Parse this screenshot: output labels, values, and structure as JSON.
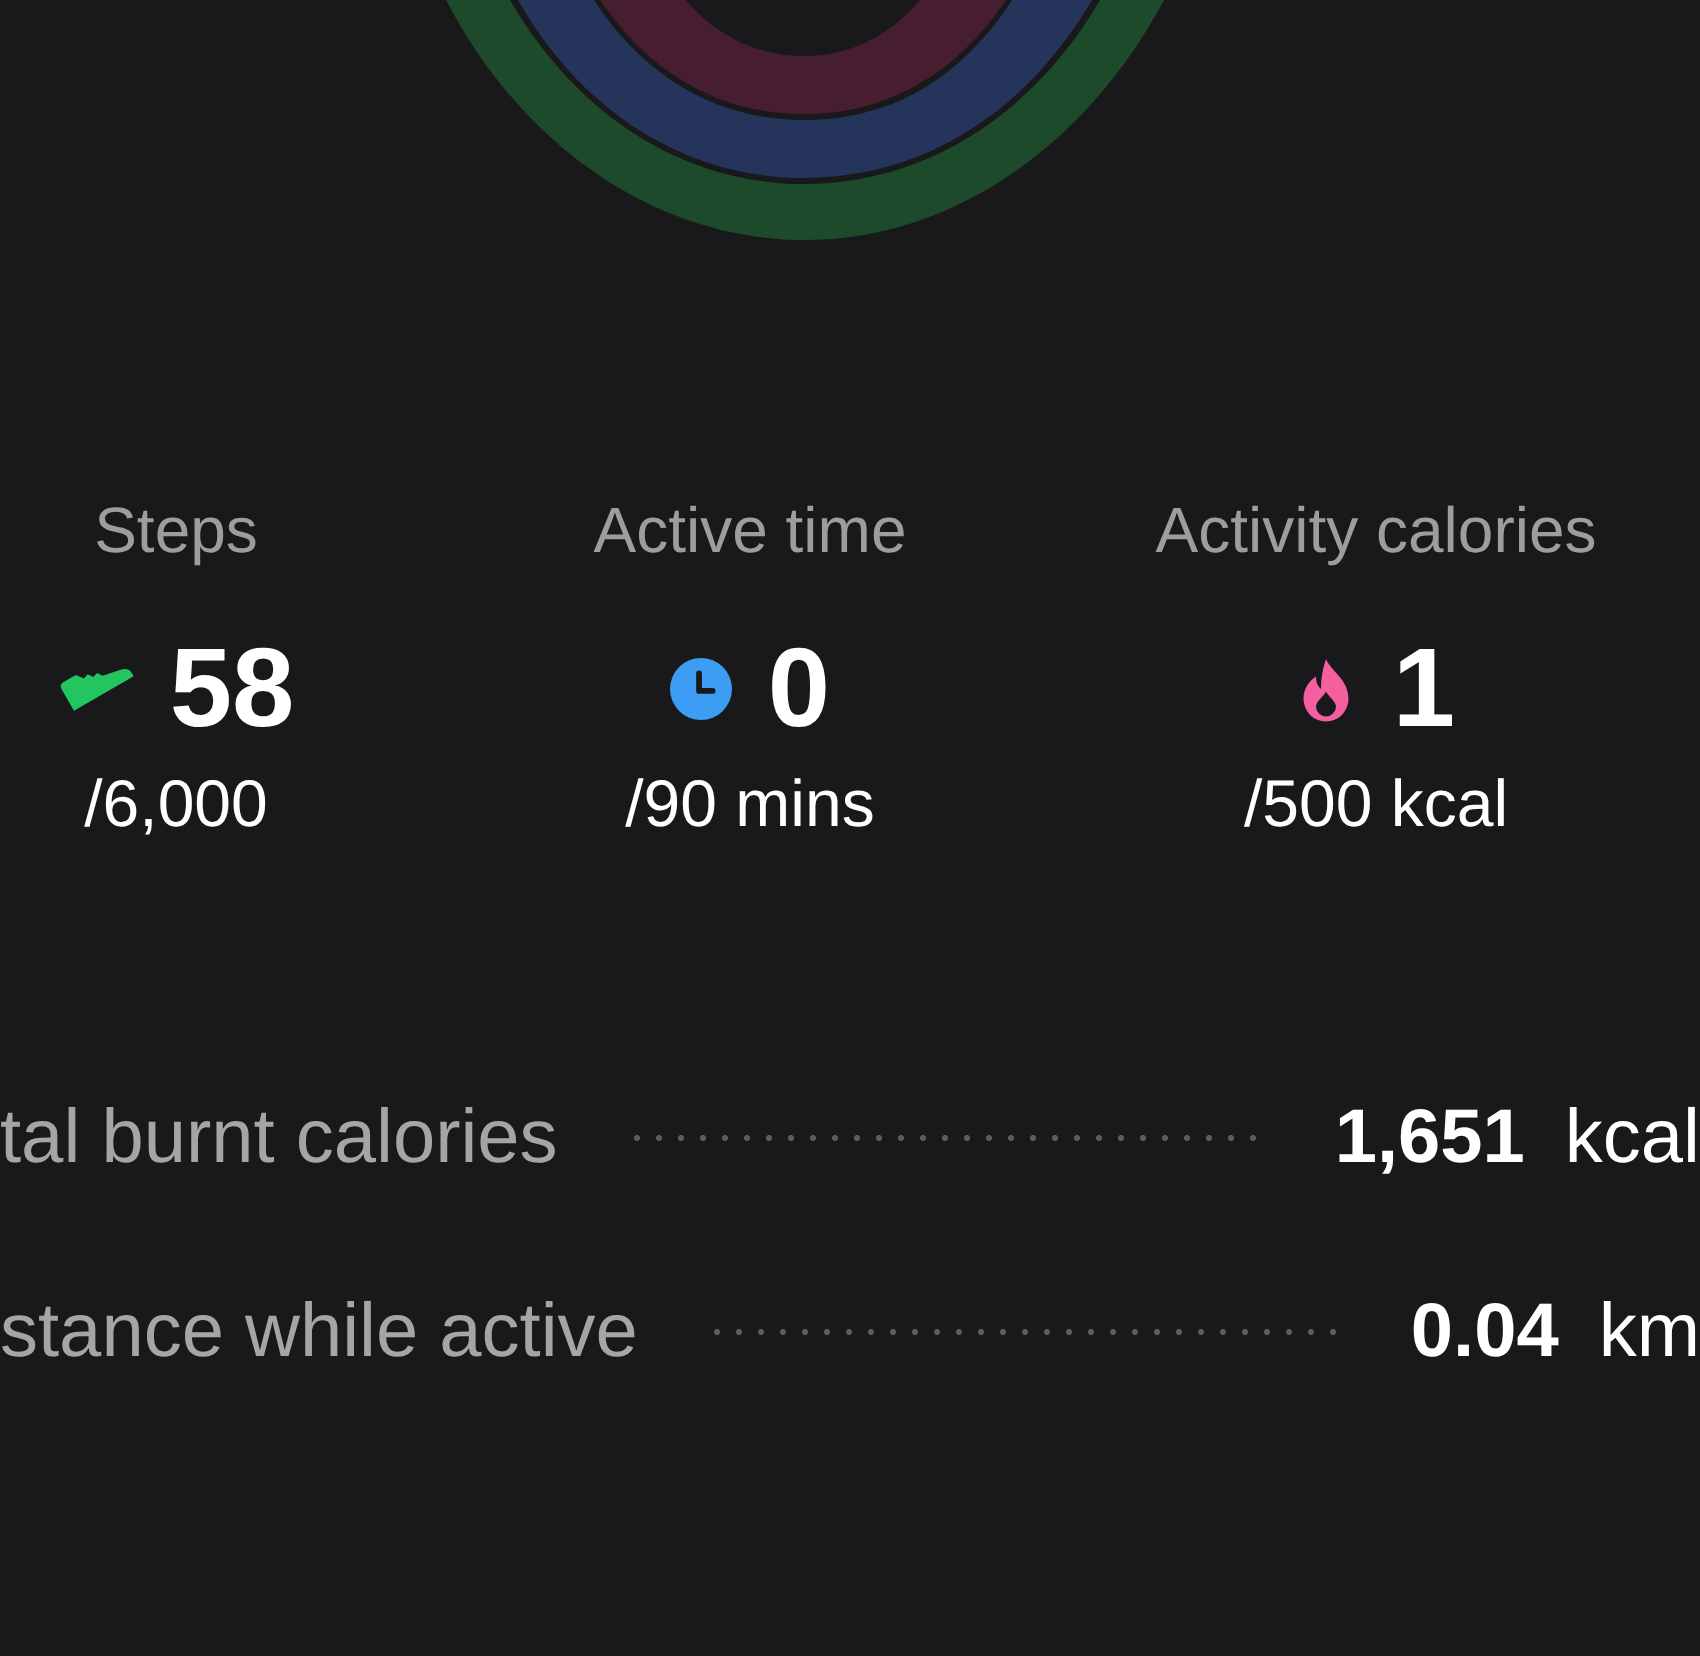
{
  "stats": [
    {
      "kind": "steps",
      "label": "Steps",
      "value": "58",
      "goal": "/6,000",
      "color": "#22c55e"
    },
    {
      "kind": "time",
      "label": "Active time",
      "value": "0",
      "goal": "/90 mins",
      "color": "#3d9cf4"
    },
    {
      "kind": "calories",
      "label": "Activity calories",
      "value": "1",
      "goal": "/500 kcal",
      "color": "#f4609f"
    }
  ],
  "summary": [
    {
      "label": "tal burnt calories",
      "value": "1,651",
      "unit": "kcal"
    },
    {
      "label": "stance while active",
      "value": "0.04",
      "unit": "km"
    }
  ]
}
